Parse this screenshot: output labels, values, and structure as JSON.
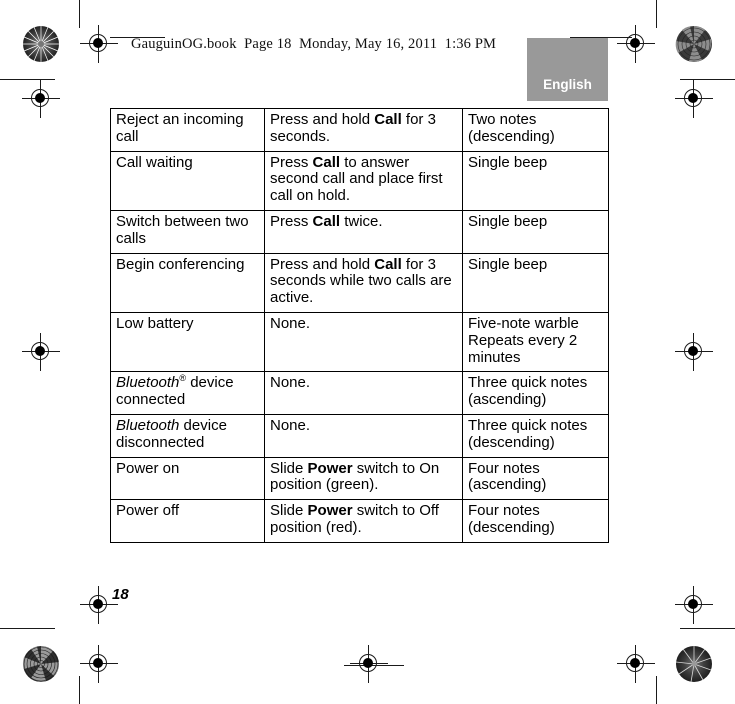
{
  "header": {
    "text": "GauguinOG.book  Page 18  Monday, May 16, 2011  1:36 PM"
  },
  "language_tab": {
    "label": "English",
    "background_color": "#999999",
    "text_color": "#ffffff"
  },
  "page_number": "18",
  "table": {
    "rows": [
      {
        "action": "Reject an incoming call",
        "howto_parts": [
          {
            "text": "Press and hold ",
            "style": "normal"
          },
          {
            "text": "Call",
            "style": "bold"
          },
          {
            "text": " for 3 seconds.",
            "style": "normal"
          }
        ],
        "sound": "Two notes (descending)"
      },
      {
        "action": "Call waiting",
        "howto_parts": [
          {
            "text": "Press ",
            "style": "normal"
          },
          {
            "text": "Call",
            "style": "bold"
          },
          {
            "text": " to answer second call and place first call on hold.",
            "style": "normal"
          }
        ],
        "sound": "Single beep"
      },
      {
        "action": "Switch between two calls",
        "howto_parts": [
          {
            "text": "Press ",
            "style": "normal"
          },
          {
            "text": "Call",
            "style": "bold"
          },
          {
            "text": " twice.",
            "style": "normal"
          }
        ],
        "sound": "Single beep"
      },
      {
        "action": "Begin conferencing",
        "howto_parts": [
          {
            "text": "Press and hold ",
            "style": "normal"
          },
          {
            "text": "Call",
            "style": "bold"
          },
          {
            "text": " for 3 seconds while two calls are active.",
            "style": "normal"
          }
        ],
        "sound": "Single beep"
      },
      {
        "action": "Low battery",
        "howto_parts": [
          {
            "text": "None.",
            "style": "normal"
          }
        ],
        "sound": "Five-note warble Repeats every 2 minutes"
      },
      {
        "action_parts": [
          {
            "text": "Bluetooth",
            "style": "italic"
          },
          {
            "text": "®",
            "style": "superscript"
          },
          {
            "text": " device connected",
            "style": "normal"
          }
        ],
        "action": "Bluetooth® device connected",
        "howto_parts": [
          {
            "text": "None.",
            "style": "normal"
          }
        ],
        "sound": "Three quick notes (ascending)"
      },
      {
        "action_parts": [
          {
            "text": "Bluetooth",
            "style": "italic"
          },
          {
            "text": " device disconnected",
            "style": "normal"
          }
        ],
        "action": "Bluetooth device disconnected",
        "howto_parts": [
          {
            "text": "None.",
            "style": "normal"
          }
        ],
        "sound": "Three quick notes (descending)"
      },
      {
        "action": "Power on",
        "howto_parts": [
          {
            "text": "Slide ",
            "style": "normal"
          },
          {
            "text": "Power",
            "style": "bold"
          },
          {
            "text": " switch to On position (green).",
            "style": "normal"
          }
        ],
        "sound": "Four notes (ascending)"
      },
      {
        "action": "Power off",
        "howto_parts": [
          {
            "text": "Slide ",
            "style": "normal"
          },
          {
            "text": "Power",
            "style": "bold"
          },
          {
            "text": " switch to Off position (red).",
            "style": "normal"
          }
        ],
        "sound": "Four notes (descending)"
      }
    ]
  },
  "print_marks": {
    "registration_targets": 8,
    "starburst_targets": 4,
    "line_color": "#1a1a1a"
  }
}
